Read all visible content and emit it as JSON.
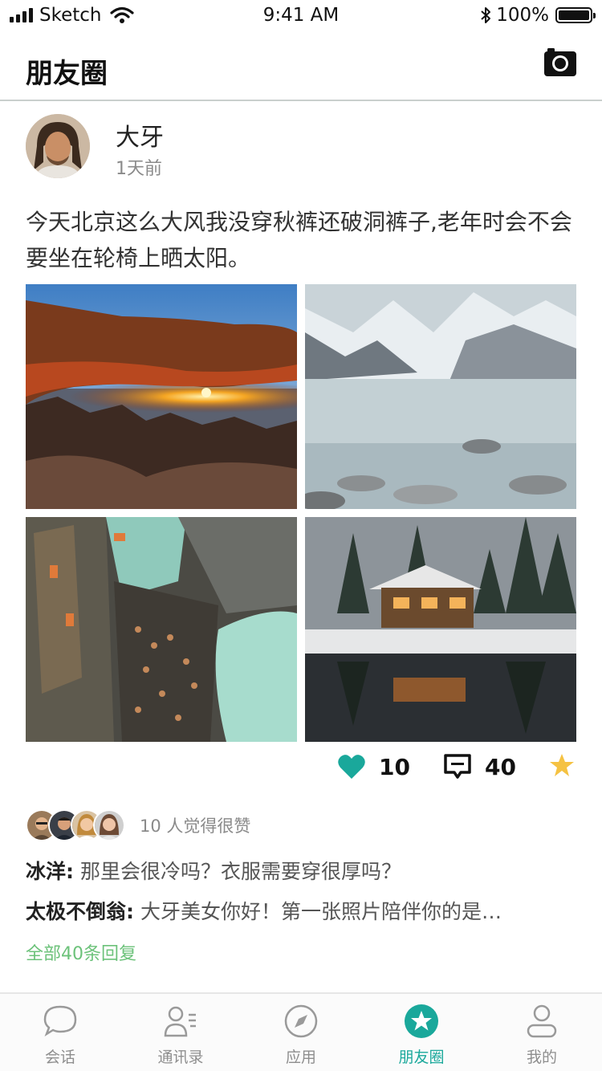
{
  "status_bar": {
    "carrier": "Sketch",
    "time": "9:41 AM",
    "battery": "100%"
  },
  "nav": {
    "title": "朋友圈",
    "camera_icon": "camera-icon"
  },
  "post": {
    "author": "大牙",
    "time": "1天前",
    "text": "今天北京这么大风我没穿秋裤还破洞裤子,老年时会不会要坐在轮椅上晒太阳。",
    "photos": [
      {
        "name": "arch-sunset-photo"
      },
      {
        "name": "snowy-mountain-lake-photo"
      },
      {
        "name": "city-street-photo"
      },
      {
        "name": "winter-cabin-photo"
      }
    ],
    "like_count": "10",
    "comment_count": "40",
    "likes_text": "10 人觉得很赞",
    "comments": [
      {
        "name": "冰洋:",
        "text": " 那里会很冷吗？衣服需要穿很厚吗？"
      },
      {
        "name": "太极不倒翁:",
        "text": " 大牙美女你好！第一张照片陪伴你的是…"
      }
    ],
    "all_replies": "全部40条回复"
  },
  "colors": {
    "accent": "#1aa89b",
    "link_green": "#6cc27a",
    "star": "#f5c242"
  },
  "tabs": [
    {
      "label": "会话",
      "icon": "chat-icon"
    },
    {
      "label": "通讯录",
      "icon": "contacts-icon"
    },
    {
      "label": "应用",
      "icon": "compass-icon"
    },
    {
      "label": "朋友圈",
      "icon": "star-icon",
      "active": true
    },
    {
      "label": "我的",
      "icon": "user-icon"
    }
  ]
}
